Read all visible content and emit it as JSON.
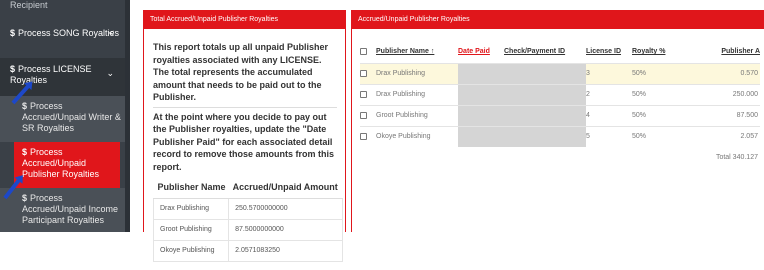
{
  "sidebar": {
    "recipient_label": "Recipient",
    "song": {
      "dollar": "$",
      "label": "Process SONG Royalties",
      "chevron": "<"
    },
    "license": {
      "dollar": "$",
      "label": "Process LICENSE Royalties",
      "chevron": "⌄"
    },
    "sub_items": [
      {
        "dollar": "$",
        "label": "Process Accrued/Unpaid Writer & SR Royalties"
      },
      {
        "dollar": "$",
        "label": "Process Accrued/Unpaid Publisher Royalties"
      },
      {
        "dollar": "$",
        "label": "Process Accrued/Unpaid Income Participant Royalties"
      }
    ]
  },
  "left_panel": {
    "title": "Total Accrued/Unpaid Publisher Royalties",
    "para1": "This report totals up all unpaid Publisher royalties associated with any LICENSE. The total represents the accumulated amount that needs to be paid out to the Publisher.",
    "para2": "At the point where you decide to pay out the Publisher royalties, update the \"Date Publisher Paid\" for each associated detail record to remove those amounts from this report.",
    "columns": [
      "Publisher Name",
      "Accrued/Unpaid Amount"
    ],
    "rows": [
      [
        "Drax Publishing",
        "250.5700000000"
      ],
      [
        "Groot Publishing",
        "87.5000000000"
      ],
      [
        "Okoye Publishing",
        "2.0571083250"
      ]
    ]
  },
  "right_panel": {
    "title": "Accrued/Unpaid Publisher Royalties",
    "columns": [
      "Publisher Name ↑",
      "Date Paid",
      "Check/Payment ID",
      "License ID",
      "Royalty %",
      "Publisher A"
    ],
    "rows": [
      [
        "Drax Publishing",
        "",
        "",
        "3",
        "50%",
        "0.570"
      ],
      [
        "Drax Publishing",
        "",
        "",
        "2",
        "50%",
        "250.000"
      ],
      [
        "Groot Publishing",
        "",
        "",
        "4",
        "50%",
        "87.500"
      ],
      [
        "Okoye Publishing",
        "",
        "",
        "5",
        "50%",
        "2.057"
      ]
    ],
    "total": "Total 340.127"
  },
  "colors": {
    "accent": "#e0161b",
    "sidebar": "#3a4047",
    "selected_row": "#fdf8dc",
    "pointer": "#1d48c9"
  }
}
